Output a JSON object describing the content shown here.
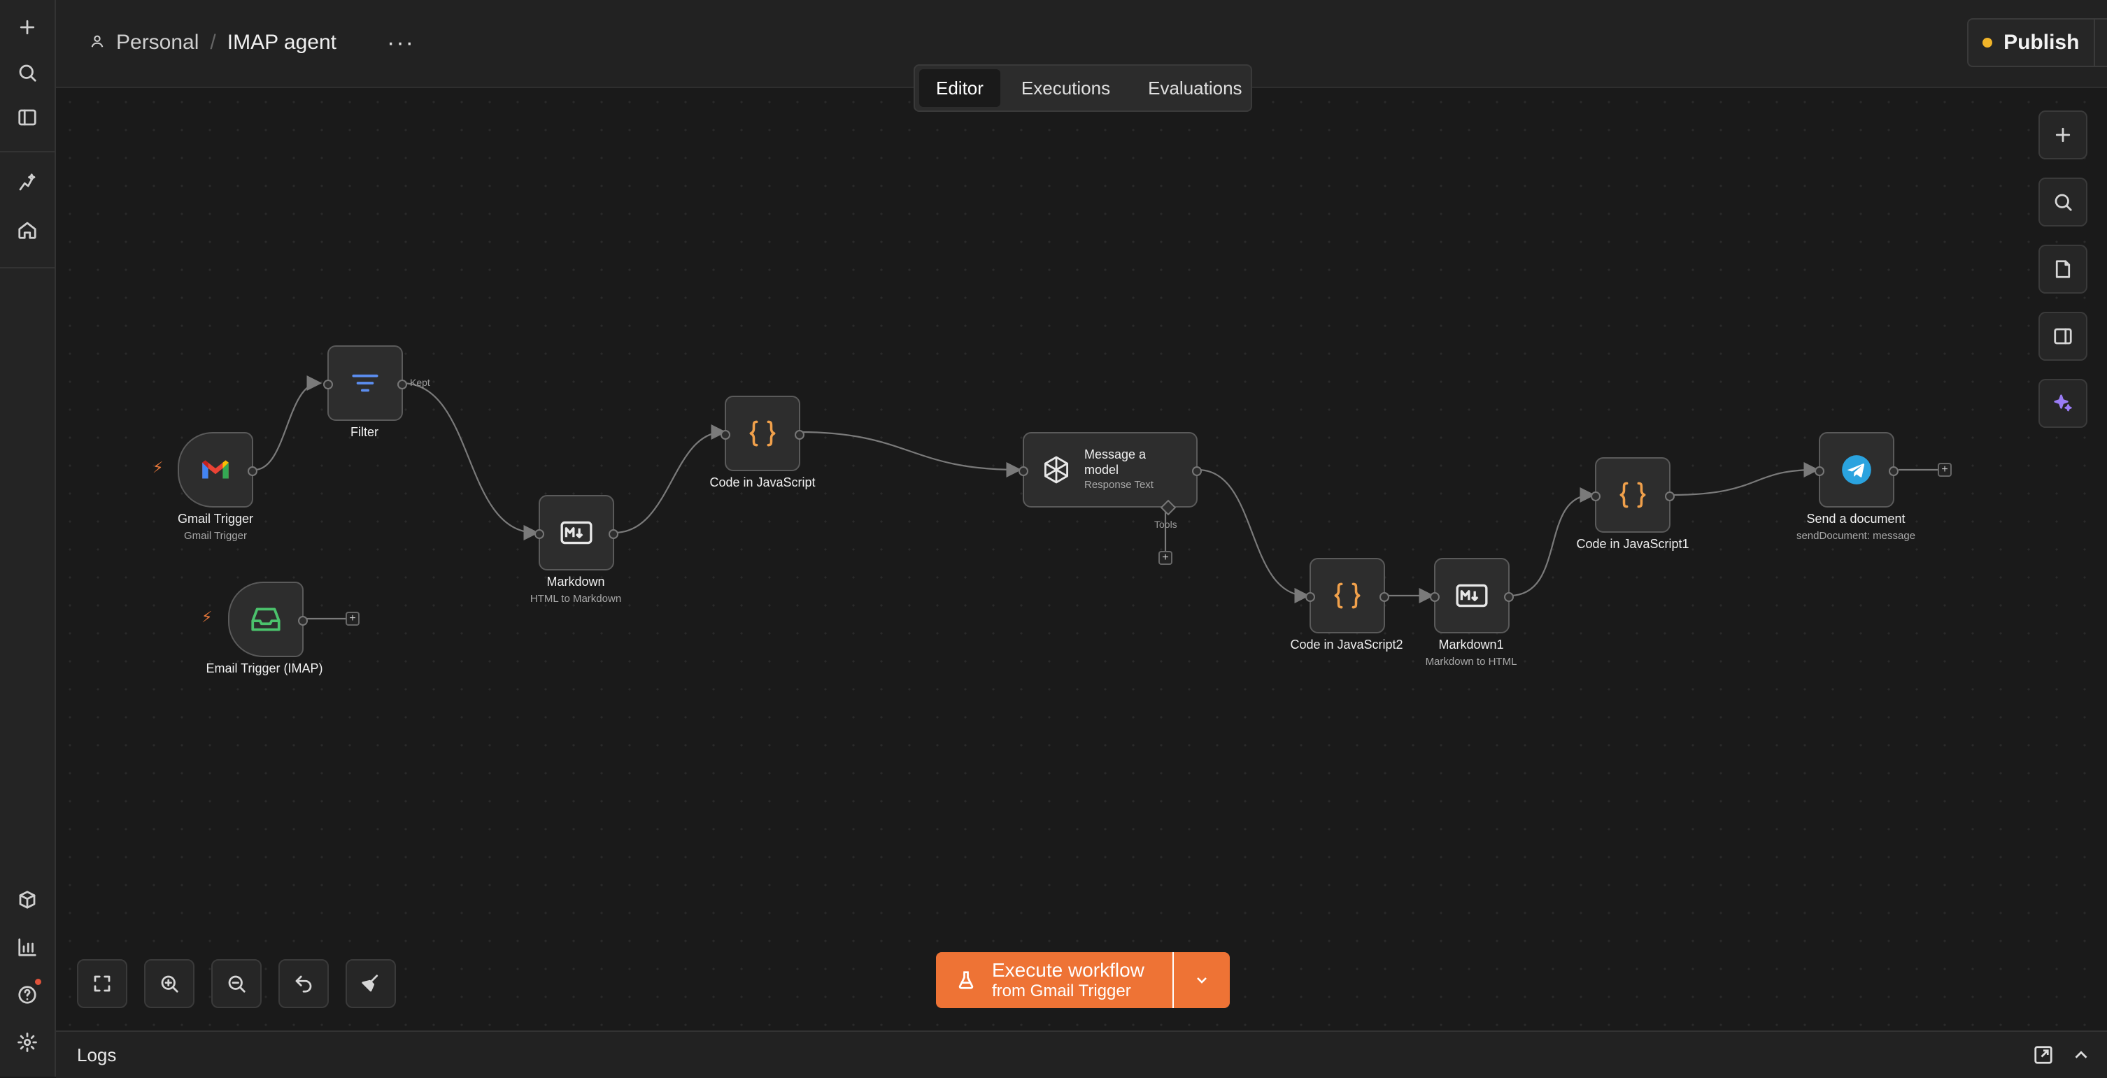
{
  "header": {
    "breadcrumb_personal": "Personal",
    "breadcrumb_separator": "/",
    "workflow_title": "IMAP agent",
    "more_label": "···",
    "publish_label": "Publish",
    "publish_status_color": "#f0b429"
  },
  "tabs": [
    {
      "label": "Editor",
      "active": true
    },
    {
      "label": "Executions",
      "active": false
    },
    {
      "label": "Evaluations",
      "active": false
    }
  ],
  "sidebar": {
    "items": [
      {
        "icon": "plus-icon"
      },
      {
        "icon": "search-icon"
      },
      {
        "icon": "sidebar-toggle-icon"
      },
      {
        "icon": "sparkle-nodes-icon"
      },
      {
        "icon": "home-icon"
      },
      {
        "icon": "packages-icon"
      },
      {
        "icon": "insights-chart-icon"
      },
      {
        "icon": "help-icon"
      },
      {
        "icon": "settings-icon"
      }
    ]
  },
  "nodes": {
    "gmail_trigger": {
      "label": "Gmail Trigger",
      "sub": "Gmail Trigger"
    },
    "email_trigger": {
      "label": "Email Trigger (IMAP)"
    },
    "filter": {
      "label": "Filter",
      "output_label": "Kept"
    },
    "markdown": {
      "label": "Markdown",
      "sub": "HTML to Markdown"
    },
    "code_js": {
      "label": "Code in JavaScript"
    },
    "message_model": {
      "title": "Message a model",
      "sub": "Response Text",
      "tools_label": "Tools"
    },
    "code_js2": {
      "label": "Code in JavaScript2"
    },
    "markdown1": {
      "label": "Markdown1",
      "sub": "Markdown to HTML"
    },
    "code_js1": {
      "label": "Code in JavaScript1"
    },
    "send_document": {
      "label": "Send a document",
      "sub": "sendDocument: message"
    }
  },
  "add_stub_label": "+",
  "execute": {
    "main": "Execute workflow",
    "sub": "from Gmail Trigger",
    "color": "#ee7335"
  },
  "logs": {
    "label": "Logs"
  }
}
